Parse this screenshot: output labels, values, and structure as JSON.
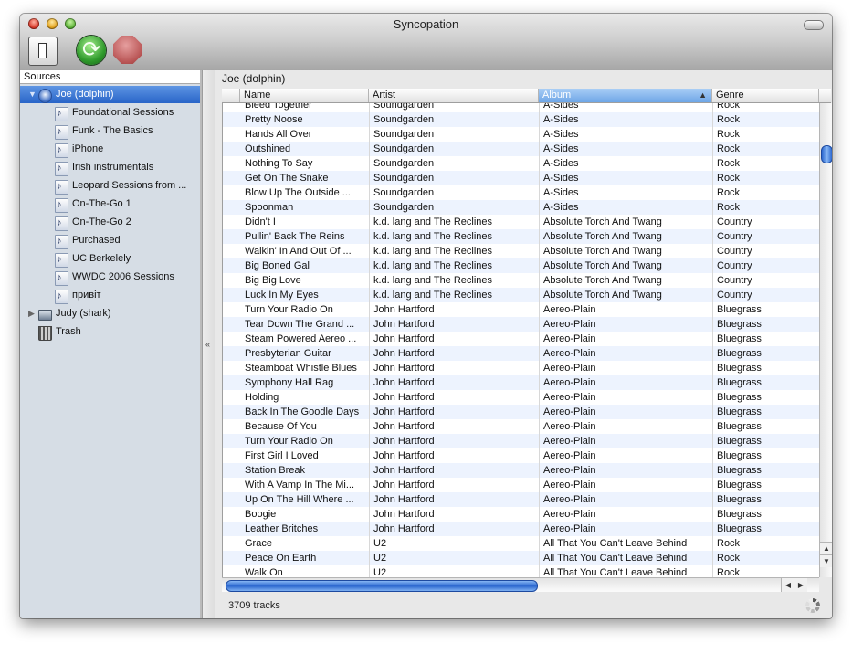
{
  "window": {
    "title": "Syncopation"
  },
  "toolbar": {
    "sidebar_toggle_icon": "sidebar-toggle-icon",
    "sync_icon": "sync-icon",
    "stop_icon": "stop-icon"
  },
  "sidebar": {
    "header": "Sources",
    "items": [
      {
        "label": "Joe (dolphin)",
        "icon": "ipod-icon",
        "level": 0,
        "expanded": true,
        "selected": true
      },
      {
        "label": "Foundational Sessions",
        "icon": "playlist-icon",
        "level": 1
      },
      {
        "label": "Funk - The Basics",
        "icon": "playlist-icon",
        "level": 1
      },
      {
        "label": "iPhone",
        "icon": "playlist-icon",
        "level": 1
      },
      {
        "label": "Irish instrumentals",
        "icon": "playlist-icon",
        "level": 1
      },
      {
        "label": "Leopard Sessions from ...",
        "icon": "playlist-icon",
        "level": 1
      },
      {
        "label": "On-The-Go 1",
        "icon": "playlist-icon",
        "level": 1
      },
      {
        "label": "On-The-Go 2",
        "icon": "playlist-icon",
        "level": 1
      },
      {
        "label": "Purchased",
        "icon": "playlist-icon",
        "level": 1
      },
      {
        "label": "UC Berkelely",
        "icon": "playlist-icon",
        "level": 1
      },
      {
        "label": "WWDC 2006 Sessions",
        "icon": "playlist-icon",
        "level": 1
      },
      {
        "label": "привіт",
        "icon": "playlist-icon",
        "level": 1
      },
      {
        "label": "Judy (shark)",
        "icon": "laptop-icon",
        "level": 0,
        "expanded": false
      },
      {
        "label": "Trash",
        "icon": "trash-icon",
        "level": 0
      }
    ]
  },
  "main": {
    "breadcrumb": "Joe (dolphin)",
    "columns": [
      {
        "label": "Name"
      },
      {
        "label": "Artist"
      },
      {
        "label": "Album",
        "sorted": true,
        "sort_arrow": "▲"
      },
      {
        "label": "Genre"
      }
    ],
    "rows": [
      [
        "Bleed Together",
        "Soundgarden",
        "A-Sides",
        "Rock"
      ],
      [
        "Pretty Noose",
        "Soundgarden",
        "A-Sides",
        "Rock"
      ],
      [
        "Hands All Over",
        "Soundgarden",
        "A-Sides",
        "Rock"
      ],
      [
        "Outshined",
        "Soundgarden",
        "A-Sides",
        "Rock"
      ],
      [
        "Nothing To Say",
        "Soundgarden",
        "A-Sides",
        "Rock"
      ],
      [
        "Get On The Snake",
        "Soundgarden",
        "A-Sides",
        "Rock"
      ],
      [
        "Blow Up The Outside ...",
        "Soundgarden",
        "A-Sides",
        "Rock"
      ],
      [
        "Spoonman",
        "Soundgarden",
        "A-Sides",
        "Rock"
      ],
      [
        "Didn't I",
        "k.d. lang and The Reclines",
        "Absolute Torch And Twang",
        "Country"
      ],
      [
        "Pullin' Back The Reins",
        "k.d. lang and The Reclines",
        "Absolute Torch And Twang",
        "Country"
      ],
      [
        "Walkin' In And Out Of ...",
        "k.d. lang and The Reclines",
        "Absolute Torch And Twang",
        "Country"
      ],
      [
        "Big Boned Gal",
        "k.d. lang and The Reclines",
        "Absolute Torch And Twang",
        "Country"
      ],
      [
        "Big Big Love",
        "k.d. lang and The Reclines",
        "Absolute Torch And Twang",
        "Country"
      ],
      [
        "Luck In My Eyes",
        "k.d. lang and The Reclines",
        "Absolute Torch And Twang",
        "Country"
      ],
      [
        "Turn Your Radio On",
        "John Hartford",
        "Aereo-Plain",
        "Bluegrass"
      ],
      [
        "Tear Down The Grand ...",
        "John Hartford",
        "Aereo-Plain",
        "Bluegrass"
      ],
      [
        "Steam Powered Aereo ...",
        "John Hartford",
        "Aereo-Plain",
        "Bluegrass"
      ],
      [
        "Presbyterian Guitar",
        "John Hartford",
        "Aereo-Plain",
        "Bluegrass"
      ],
      [
        "Steamboat Whistle Blues",
        "John Hartford",
        "Aereo-Plain",
        "Bluegrass"
      ],
      [
        "Symphony Hall Rag",
        "John Hartford",
        "Aereo-Plain",
        "Bluegrass"
      ],
      [
        "Holding",
        "John Hartford",
        "Aereo-Plain",
        "Bluegrass"
      ],
      [
        "Back In The Goodle Days",
        "John Hartford",
        "Aereo-Plain",
        "Bluegrass"
      ],
      [
        "Because Of You",
        "John Hartford",
        "Aereo-Plain",
        "Bluegrass"
      ],
      [
        "Turn Your Radio On",
        "John Hartford",
        "Aereo-Plain",
        "Bluegrass"
      ],
      [
        "First Girl I Loved",
        "John Hartford",
        "Aereo-Plain",
        "Bluegrass"
      ],
      [
        "Station Break",
        "John Hartford",
        "Aereo-Plain",
        "Bluegrass"
      ],
      [
        "With A Vamp In The Mi...",
        "John Hartford",
        "Aereo-Plain",
        "Bluegrass"
      ],
      [
        "Up On The Hill Where ...",
        "John Hartford",
        "Aereo-Plain",
        "Bluegrass"
      ],
      [
        "Boogie",
        "John Hartford",
        "Aereo-Plain",
        "Bluegrass"
      ],
      [
        "Leather Britches",
        "John Hartford",
        "Aereo-Plain",
        "Bluegrass"
      ],
      [
        "Grace",
        "U2",
        "All That You Can't Leave Behind",
        "Rock"
      ],
      [
        "Peace On Earth",
        "U2",
        "All That You Can't Leave Behind",
        "Rock"
      ],
      [
        "Walk On",
        "U2",
        "All That You Can't Leave Behind",
        "Rock"
      ]
    ],
    "vertical_scroll_position": 0.08,
    "horizontal_scroll_position": 0.0
  },
  "status": {
    "track_count": "3709 tracks"
  },
  "colors": {
    "selection": "#2864c8",
    "alt_row": "#edf3fe",
    "sidebar_bg": "#d6dde5"
  }
}
